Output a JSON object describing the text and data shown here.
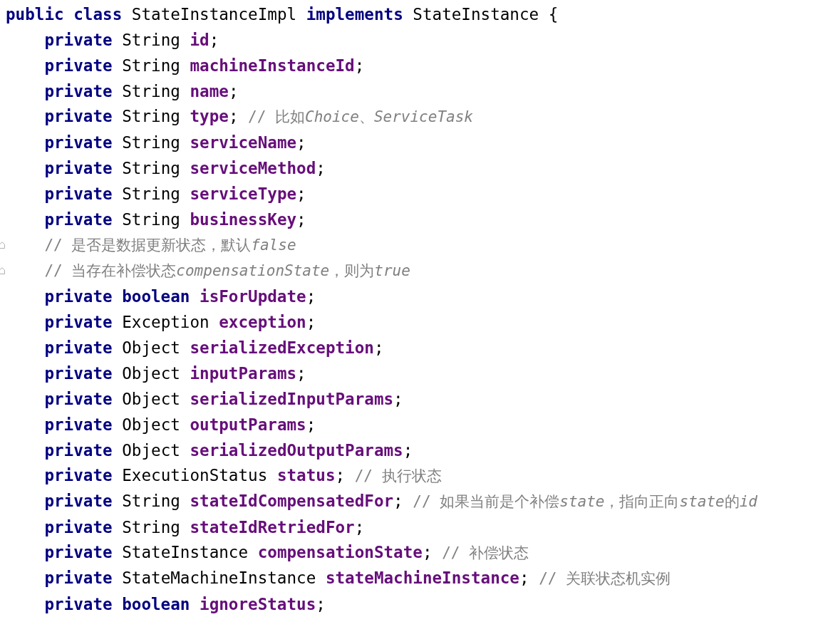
{
  "code_lines": [
    {
      "fold_marker": false,
      "tokens": [
        {
          "kind": "keyword",
          "text": "public class"
        },
        {
          "kind": "plain",
          "text": "StateInstanceImpl"
        },
        {
          "kind": "keyword",
          "text": "implements"
        },
        {
          "kind": "plain",
          "text": "StateInstance {"
        }
      ],
      "children": [
        {
          "fold_marker": false,
          "tokens": [
            {
              "kind": "keyword",
              "text": "private"
            },
            {
              "kind": "plain",
              "text": "String"
            },
            {
              "kind": "field",
              "text": "id"
            },
            {
              "kind": "punct",
              "text": ";"
            }
          ]
        },
        {
          "fold_marker": false,
          "tokens": [
            {
              "kind": "keyword",
              "text": "private"
            },
            {
              "kind": "plain",
              "text": "String"
            },
            {
              "kind": "field",
              "text": "machineInstanceId"
            },
            {
              "kind": "punct",
              "text": ";"
            }
          ]
        },
        {
          "fold_marker": false,
          "tokens": [
            {
              "kind": "keyword",
              "text": "private"
            },
            {
              "kind": "plain",
              "text": "String"
            },
            {
              "kind": "field",
              "text": "name"
            },
            {
              "kind": "punct",
              "text": ";"
            }
          ]
        },
        {
          "fold_marker": false,
          "tokens": [
            {
              "kind": "keyword",
              "text": "private"
            },
            {
              "kind": "plain",
              "text": "String"
            },
            {
              "kind": "field",
              "text": "type"
            },
            {
              "kind": "punct",
              "text": ";"
            },
            {
              "kind": "comment",
              "text": "// 比如"
            },
            {
              "kind": "comment_italic",
              "text": "Choice"
            },
            {
              "kind": "comment",
              "text": "、"
            },
            {
              "kind": "comment_italic",
              "text": "ServiceTask"
            }
          ]
        },
        {
          "fold_marker": false,
          "tokens": [
            {
              "kind": "keyword",
              "text": "private"
            },
            {
              "kind": "plain",
              "text": "String"
            },
            {
              "kind": "field",
              "text": "serviceName"
            },
            {
              "kind": "punct",
              "text": ";"
            }
          ]
        },
        {
          "fold_marker": false,
          "tokens": [
            {
              "kind": "keyword",
              "text": "private"
            },
            {
              "kind": "plain",
              "text": "String"
            },
            {
              "kind": "field",
              "text": "serviceMethod"
            },
            {
              "kind": "punct",
              "text": ";"
            }
          ]
        },
        {
          "fold_marker": false,
          "tokens": [
            {
              "kind": "keyword",
              "text": "private"
            },
            {
              "kind": "plain",
              "text": "String"
            },
            {
              "kind": "field",
              "text": "serviceType"
            },
            {
              "kind": "punct",
              "text": ";"
            }
          ]
        },
        {
          "fold_marker": false,
          "tokens": [
            {
              "kind": "keyword",
              "text": "private"
            },
            {
              "kind": "plain",
              "text": "String"
            },
            {
              "kind": "field",
              "text": "businessKey"
            },
            {
              "kind": "punct",
              "text": ";"
            }
          ]
        },
        {
          "fold_marker": true,
          "tokens": [
            {
              "kind": "comment",
              "text": "// 是否是数据更新状态，默认"
            },
            {
              "kind": "comment_italic",
              "text": "false"
            }
          ]
        },
        {
          "fold_marker": true,
          "tokens": [
            {
              "kind": "comment",
              "text": "// 当存在补偿状态"
            },
            {
              "kind": "comment_italic",
              "text": "compensationState"
            },
            {
              "kind": "comment",
              "text": "，则为"
            },
            {
              "kind": "comment_italic",
              "text": "true"
            }
          ]
        },
        {
          "fold_marker": false,
          "tokens": [
            {
              "kind": "keyword",
              "text": "private boolean"
            },
            {
              "kind": "field",
              "text": "isForUpdate"
            },
            {
              "kind": "punct",
              "text": ";"
            }
          ]
        },
        {
          "fold_marker": false,
          "tokens": [
            {
              "kind": "keyword",
              "text": "private"
            },
            {
              "kind": "plain",
              "text": "Exception"
            },
            {
              "kind": "field",
              "text": "exception"
            },
            {
              "kind": "punct",
              "text": ";"
            }
          ]
        },
        {
          "fold_marker": false,
          "tokens": [
            {
              "kind": "keyword",
              "text": "private"
            },
            {
              "kind": "plain",
              "text": "Object"
            },
            {
              "kind": "field",
              "text": "serializedException"
            },
            {
              "kind": "punct",
              "text": ";"
            }
          ]
        },
        {
          "fold_marker": false,
          "tokens": [
            {
              "kind": "keyword",
              "text": "private"
            },
            {
              "kind": "plain",
              "text": "Object"
            },
            {
              "kind": "field",
              "text": "inputParams"
            },
            {
              "kind": "punct",
              "text": ";"
            }
          ]
        },
        {
          "fold_marker": false,
          "tokens": [
            {
              "kind": "keyword",
              "text": "private"
            },
            {
              "kind": "plain",
              "text": "Object"
            },
            {
              "kind": "field",
              "text": "serializedInputParams"
            },
            {
              "kind": "punct",
              "text": ";"
            }
          ]
        },
        {
          "fold_marker": false,
          "tokens": [
            {
              "kind": "keyword",
              "text": "private"
            },
            {
              "kind": "plain",
              "text": "Object"
            },
            {
              "kind": "field",
              "text": "outputParams"
            },
            {
              "kind": "punct",
              "text": ";"
            }
          ]
        },
        {
          "fold_marker": false,
          "tokens": [
            {
              "kind": "keyword",
              "text": "private"
            },
            {
              "kind": "plain",
              "text": "Object"
            },
            {
              "kind": "field",
              "text": "serializedOutputParams"
            },
            {
              "kind": "punct",
              "text": ";"
            }
          ]
        },
        {
          "fold_marker": false,
          "tokens": [
            {
              "kind": "keyword",
              "text": "private"
            },
            {
              "kind": "plain",
              "text": "ExecutionStatus"
            },
            {
              "kind": "field",
              "text": "status"
            },
            {
              "kind": "punct",
              "text": ";"
            },
            {
              "kind": "comment",
              "text": "// 执行状态"
            }
          ]
        },
        {
          "fold_marker": false,
          "tokens": [
            {
              "kind": "keyword",
              "text": "private"
            },
            {
              "kind": "plain",
              "text": "String"
            },
            {
              "kind": "field",
              "text": "stateIdCompensatedFor"
            },
            {
              "kind": "punct",
              "text": ";"
            },
            {
              "kind": "comment",
              "text": "// 如果当前是个补偿"
            },
            {
              "kind": "comment_italic",
              "text": "state"
            },
            {
              "kind": "comment",
              "text": "，指向正向"
            },
            {
              "kind": "comment_italic",
              "text": "state"
            },
            {
              "kind": "comment",
              "text": "的"
            },
            {
              "kind": "comment_italic",
              "text": "id"
            }
          ]
        },
        {
          "fold_marker": false,
          "tokens": [
            {
              "kind": "keyword",
              "text": "private"
            },
            {
              "kind": "plain",
              "text": "String"
            },
            {
              "kind": "field",
              "text": "stateIdRetriedFor"
            },
            {
              "kind": "punct",
              "text": ";"
            }
          ]
        },
        {
          "fold_marker": false,
          "tokens": [
            {
              "kind": "keyword",
              "text": "private"
            },
            {
              "kind": "plain",
              "text": "StateInstance"
            },
            {
              "kind": "field",
              "text": "compensationState"
            },
            {
              "kind": "punct",
              "text": ";"
            },
            {
              "kind": "comment",
              "text": "// 补偿状态"
            }
          ]
        },
        {
          "fold_marker": false,
          "tokens": [
            {
              "kind": "keyword",
              "text": "private"
            },
            {
              "kind": "plain",
              "text": "StateMachineInstance"
            },
            {
              "kind": "field",
              "text": "stateMachineInstance"
            },
            {
              "kind": "punct",
              "text": ";"
            },
            {
              "kind": "comment",
              "text": "// 关联状态机实例"
            }
          ]
        },
        {
          "fold_marker": false,
          "tokens": [
            {
              "kind": "keyword",
              "text": "private boolean"
            },
            {
              "kind": "field",
              "text": "ignoreStatus"
            },
            {
              "kind": "punct",
              "text": ";"
            }
          ]
        }
      ]
    }
  ]
}
